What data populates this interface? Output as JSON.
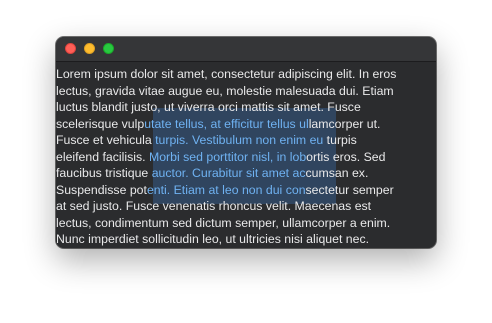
{
  "window": {
    "controls": {
      "close_color": "#ff5f57",
      "minimize_color": "#febc2e",
      "maximize_color": "#28c840"
    }
  },
  "text_view": {
    "lines": [
      {
        "before": "Lorem ipsum dolor sit amet, consectetur adipiscing elit. In eros",
        "selected": "",
        "after": ""
      },
      {
        "before": "lectus, gravida vitae augue eu, molestie malesuada dui. Etiam",
        "selected": "",
        "after": ""
      },
      {
        "before": "luctus blandit justo, ut viverra orci mattis sit amet. Fusce",
        "selected": "",
        "after": ""
      },
      {
        "before": "scelerisque vulp",
        "selected": "utate tellus, at efficitur tellus ul",
        "after": "lamcorper ut."
      },
      {
        "before": "Fusce et vehicula ",
        "selected": "turpis. Vestibulum non enim eu",
        "after": " turpis"
      },
      {
        "before": "eleifend facilisis. ",
        "selected": "Morbi sed porttitor nisl, in lob",
        "after": "ortis eros. Sed"
      },
      {
        "before": "faucibus tristique ",
        "selected": "auctor. Curabitur sit amet ac",
        "after": "cumsan ex."
      },
      {
        "before": "Suspendisse pot",
        "selected": "enti. Etiam at leo non dui con",
        "after": "sectetur semper"
      },
      {
        "before": "at sed justo. Fusce venenatis rhoncus velit. Maecenas est",
        "selected": "",
        "after": ""
      },
      {
        "before": "lectus, condimentum sed dictum semper, ullamcorper a enim.",
        "selected": "",
        "after": ""
      },
      {
        "before": "Nunc imperdiet sollicitudin leo, ut ultricies nisi aliquet nec.",
        "selected": "",
        "after": ""
      }
    ]
  },
  "colors": {
    "text": "#e9e9ea",
    "selected_text": "#6fb2f2",
    "background": "#2b2c2e"
  }
}
